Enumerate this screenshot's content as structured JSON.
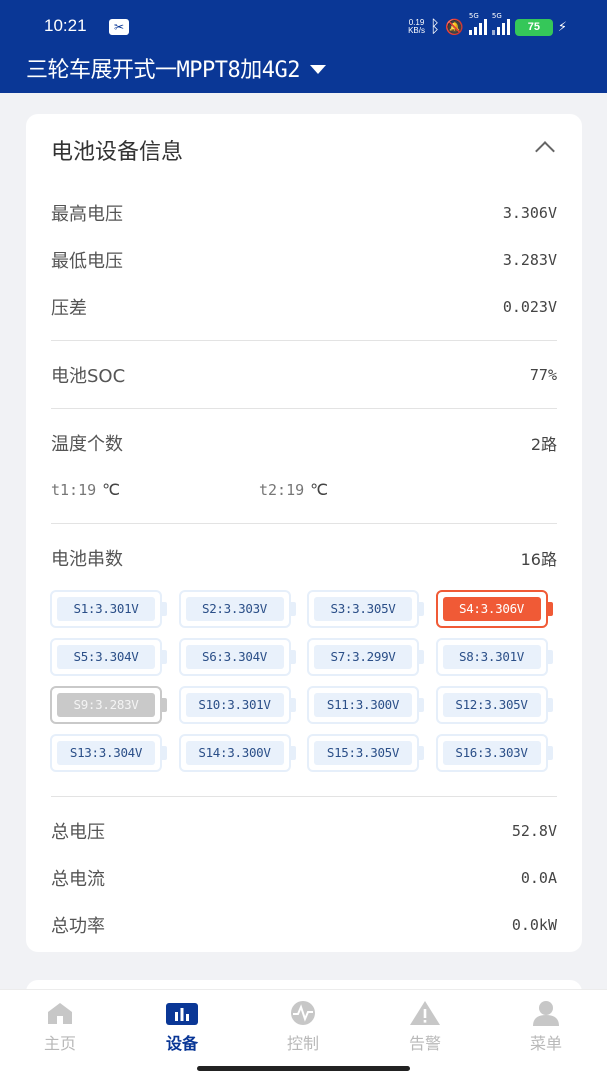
{
  "status_bar": {
    "time": "10:21",
    "net_speed_value": "0.19",
    "net_speed_unit": "KB/s",
    "battery": "75",
    "network_1": "5G",
    "network_2": "5G",
    "colors": {
      "bar": "#0a3796",
      "battery": "#35c759"
    }
  },
  "header": {
    "title": "三轮车展开式一MPPT8加4G2",
    "dropdown_icon": "caret-down-icon"
  },
  "card": {
    "title": "电池设备信息",
    "collapse_icon": "chevron-up-icon",
    "max_voltage": {
      "label": "最高电压",
      "value": "3.306V"
    },
    "min_voltage": {
      "label": "最低电压",
      "value": "3.283V"
    },
    "voltage_diff": {
      "label": "压差",
      "value": "0.023V"
    },
    "soc": {
      "label": "电池SOC",
      "value": "77%"
    },
    "temp_count": {
      "label": "温度个数",
      "value": "2路"
    },
    "temps": [
      {
        "label": "t1:19",
        "unit": "℃"
      },
      {
        "label": "t2:19",
        "unit": "℃"
      }
    ],
    "cell_count": {
      "label": "电池串数",
      "value": "16路"
    },
    "cells": [
      {
        "text": "S1:3.301V",
        "state": "normal"
      },
      {
        "text": "S2:3.303V",
        "state": "normal"
      },
      {
        "text": "S3:3.305V",
        "state": "normal"
      },
      {
        "text": "S4:3.306V",
        "state": "max"
      },
      {
        "text": "S5:3.304V",
        "state": "normal"
      },
      {
        "text": "S6:3.304V",
        "state": "normal"
      },
      {
        "text": "S7:3.299V",
        "state": "normal"
      },
      {
        "text": "S8:3.301V",
        "state": "normal"
      },
      {
        "text": "S9:3.283V",
        "state": "min"
      },
      {
        "text": "S10:3.301V",
        "state": "normal"
      },
      {
        "text": "S11:3.300V",
        "state": "normal"
      },
      {
        "text": "S12:3.305V",
        "state": "normal"
      },
      {
        "text": "S13:3.304V",
        "state": "normal"
      },
      {
        "text": "S14:3.300V",
        "state": "normal"
      },
      {
        "text": "S15:3.305V",
        "state": "normal"
      },
      {
        "text": "S16:3.303V",
        "state": "normal"
      }
    ],
    "total_voltage": {
      "label": "总电压",
      "value": "52.8V"
    },
    "total_current": {
      "label": "总电流",
      "value": "0.0A"
    },
    "total_power": {
      "label": "总功率",
      "value": "0.0kW"
    },
    "colors": {
      "max_cell": "#f05a36",
      "min_cell": "#c9c9c9",
      "cell_bg": "#e9f1fb"
    }
  },
  "bottom_nav": {
    "items": [
      {
        "label": "主页",
        "icon": "home-icon"
      },
      {
        "label": "设备",
        "icon": "device-chart-icon",
        "active": true
      },
      {
        "label": "控制",
        "icon": "control-pulse-icon"
      },
      {
        "label": "告警",
        "icon": "alarm-warning-icon"
      },
      {
        "label": "菜单",
        "icon": "menu-user-icon"
      }
    ],
    "colors": {
      "active": "#0a3796",
      "inactive": "#b9b9b9"
    }
  }
}
